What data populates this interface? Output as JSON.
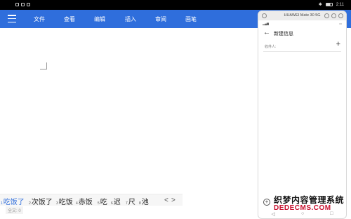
{
  "status_bar": {
    "time": "2:11"
  },
  "toolbar": {
    "menu_icon": "hamburger-icon",
    "items": [
      "文件",
      "查看",
      "编辑",
      "插入",
      "审阅",
      "画笔"
    ]
  },
  "candidates": [
    {
      "num": "1",
      "text": "吃饭了"
    },
    {
      "num": "2",
      "text": "次饭了"
    },
    {
      "num": "3",
      "text": "吃饭"
    },
    {
      "num": "4",
      "text": "赤饭"
    },
    {
      "num": "5",
      "text": "吃"
    },
    {
      "num": "6",
      "text": "迟"
    },
    {
      "num": "7",
      "text": "尺"
    },
    {
      "num": "8",
      "text": "池"
    }
  ],
  "candidate_nav": {
    "prev": "<",
    "next": ">"
  },
  "word_count": "全文: 0",
  "phone": {
    "window_title": "HUAWEI Mate 30 5G",
    "page_title": "新建信息",
    "recipient_label": "收件人:",
    "add_icon": "plus-icon",
    "back_icon": "back-arrow-icon"
  },
  "watermark": {
    "line1": "织梦内容管理系统",
    "line2": "DEDECMS.COM"
  }
}
